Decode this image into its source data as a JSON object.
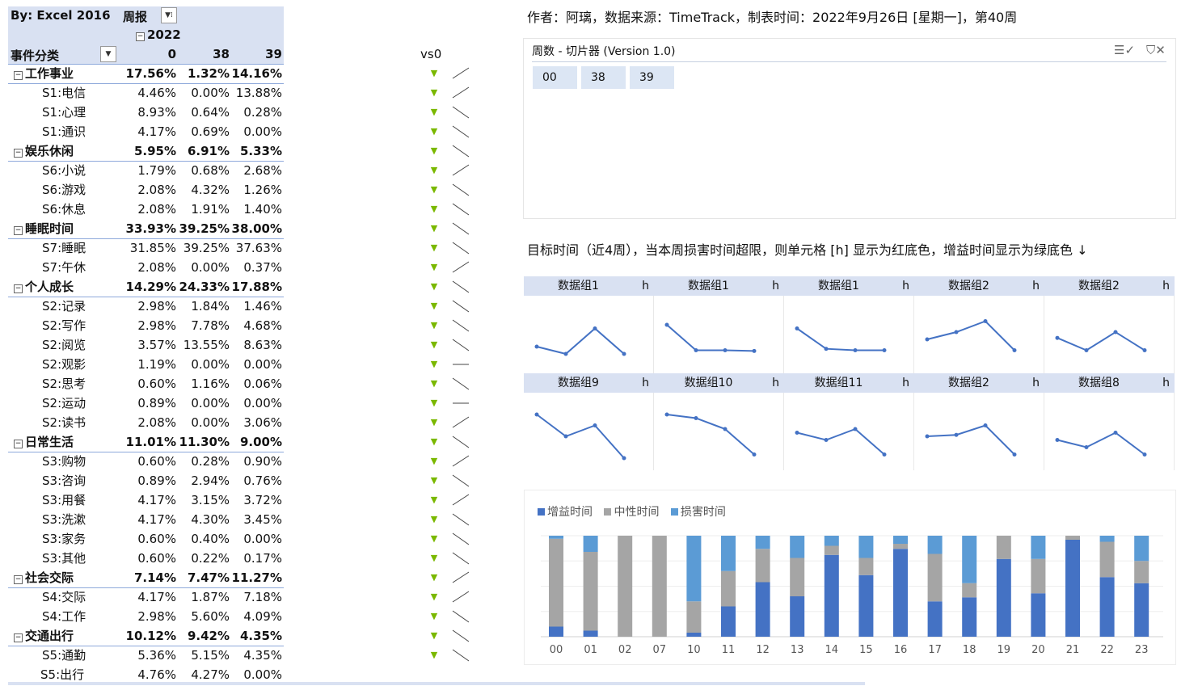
{
  "pivot": {
    "title": "By:  Excel 2016",
    "filter_label": "周报",
    "year": "2022",
    "row_header": "事件分类",
    "columns": [
      "0",
      "38",
      "39"
    ],
    "rows": [
      {
        "label": "工作事业",
        "type": "cat",
        "values": [
          "17.56%",
          "1.32%",
          "14.16%"
        ],
        "trend": "up"
      },
      {
        "label": "S1:电信",
        "type": "sub",
        "values": [
          "4.46%",
          "0.00%",
          "13.88%"
        ],
        "trend": "up"
      },
      {
        "label": "S1:心理",
        "type": "sub",
        "values": [
          "8.93%",
          "0.64%",
          "0.28%"
        ],
        "trend": "down"
      },
      {
        "label": "S1:通识",
        "type": "sub",
        "values": [
          "4.17%",
          "0.69%",
          "0.00%"
        ],
        "trend": "down"
      },
      {
        "label": "娱乐休闲",
        "type": "cat",
        "values": [
          "5.95%",
          "6.91%",
          "5.33%"
        ],
        "trend": "down"
      },
      {
        "label": "S6:小说",
        "type": "sub",
        "values": [
          "1.79%",
          "0.68%",
          "2.68%"
        ],
        "trend": "up"
      },
      {
        "label": "S6:游戏",
        "type": "sub",
        "values": [
          "2.08%",
          "4.32%",
          "1.26%"
        ],
        "trend": "down"
      },
      {
        "label": "S6:休息",
        "type": "sub",
        "values": [
          "2.08%",
          "1.91%",
          "1.40%"
        ],
        "trend": "down"
      },
      {
        "label": "睡眠时间",
        "type": "cat",
        "values": [
          "33.93%",
          "39.25%",
          "38.00%"
        ],
        "trend": "down"
      },
      {
        "label": "S7:睡眠",
        "type": "sub",
        "values": [
          "31.85%",
          "39.25%",
          "37.63%"
        ],
        "trend": "down"
      },
      {
        "label": "S7:午休",
        "type": "sub",
        "values": [
          "2.08%",
          "0.00%",
          "0.37%"
        ],
        "trend": "up"
      },
      {
        "label": "个人成长",
        "type": "cat",
        "values": [
          "14.29%",
          "24.33%",
          "17.88%"
        ],
        "trend": "down"
      },
      {
        "label": "S2:记录",
        "type": "sub",
        "values": [
          "2.98%",
          "1.84%",
          "1.46%"
        ],
        "trend": "down"
      },
      {
        "label": "S2:写作",
        "type": "sub",
        "values": [
          "2.98%",
          "7.78%",
          "4.68%"
        ],
        "trend": "down"
      },
      {
        "label": "S2:阅览",
        "type": "sub",
        "values": [
          "3.57%",
          "13.55%",
          "8.63%"
        ],
        "trend": "down"
      },
      {
        "label": "S2:观影",
        "type": "sub",
        "values": [
          "1.19%",
          "0.00%",
          "0.00%"
        ],
        "trend": "flat"
      },
      {
        "label": "S2:思考",
        "type": "sub",
        "values": [
          "0.60%",
          "1.16%",
          "0.06%"
        ],
        "trend": "down"
      },
      {
        "label": "S2:运动",
        "type": "sub",
        "values": [
          "0.89%",
          "0.00%",
          "0.00%"
        ],
        "trend": "flat"
      },
      {
        "label": "S2:读书",
        "type": "sub",
        "values": [
          "2.08%",
          "0.00%",
          "3.06%"
        ],
        "trend": "up"
      },
      {
        "label": "日常生活",
        "type": "cat",
        "values": [
          "11.01%",
          "11.30%",
          "9.00%"
        ],
        "trend": "down"
      },
      {
        "label": "S3:购物",
        "type": "sub",
        "values": [
          "0.60%",
          "0.28%",
          "0.90%"
        ],
        "trend": "up"
      },
      {
        "label": "S3:咨询",
        "type": "sub",
        "values": [
          "0.89%",
          "2.94%",
          "0.76%"
        ],
        "trend": "down"
      },
      {
        "label": "S3:用餐",
        "type": "sub",
        "values": [
          "4.17%",
          "3.15%",
          "3.72%"
        ],
        "trend": "up"
      },
      {
        "label": "S3:洗漱",
        "type": "sub",
        "values": [
          "4.17%",
          "4.30%",
          "3.45%"
        ],
        "trend": "down"
      },
      {
        "label": "S3:家务",
        "type": "sub",
        "values": [
          "0.60%",
          "0.40%",
          "0.00%"
        ],
        "trend": "down"
      },
      {
        "label": "S3:其他",
        "type": "sub",
        "values": [
          "0.60%",
          "0.22%",
          "0.17%"
        ],
        "trend": "down"
      },
      {
        "label": "社会交际",
        "type": "cat",
        "values": [
          "7.14%",
          "7.47%",
          "11.27%"
        ],
        "trend": "up"
      },
      {
        "label": "S4:交际",
        "type": "sub",
        "values": [
          "4.17%",
          "1.87%",
          "7.18%"
        ],
        "trend": "up"
      },
      {
        "label": "S4:工作",
        "type": "sub",
        "values": [
          "2.98%",
          "5.60%",
          "4.09%"
        ],
        "trend": "down"
      },
      {
        "label": "交通出行",
        "type": "cat",
        "values": [
          "10.12%",
          "9.42%",
          "4.35%"
        ],
        "trend": "down"
      },
      {
        "label": "S5:通勤",
        "type": "sub",
        "values": [
          "5.36%",
          "5.15%",
          "4.35%"
        ],
        "trend": "down"
      },
      {
        "label": "S5:出行",
        "type": "sub",
        "values": [
          "4.76%",
          "4.27%",
          "0.00%"
        ],
        "trend": "none"
      }
    ]
  },
  "vs_label": "vs0",
  "top_note": "作者：阿璃，数据来源：TimeTrack，制表时间：2022年9月26日 [星期一]，第40周",
  "slicer": {
    "title": "周数 - 切片器  (Version 1.0)",
    "items": [
      "00",
      "38",
      "39"
    ]
  },
  "note2": "目标时间（近4周），当本周损害时间超限，则单元格 [h] 显示为红底色，增益时间显示为绿底色 ↓",
  "sparklines": [
    {
      "name": "数据组1",
      "unit": "h",
      "values": [
        0.3,
        0.2,
        0.55,
        0.2
      ]
    },
    {
      "name": "数据组1",
      "unit": "h",
      "values": [
        0.6,
        0.25,
        0.25,
        0.24
      ]
    },
    {
      "name": "数据组1",
      "unit": "h",
      "values": [
        0.55,
        0.27,
        0.25,
        0.25
      ]
    },
    {
      "name": "数据组2",
      "unit": "h",
      "values": [
        0.4,
        0.5,
        0.65,
        0.25
      ]
    },
    {
      "name": "数据组2",
      "unit": "h",
      "values": [
        0.42,
        0.25,
        0.5,
        0.25
      ]
    },
    {
      "name": "数据组9",
      "unit": "h",
      "values": [
        0.7,
        0.4,
        0.55,
        0.1
      ]
    },
    {
      "name": "数据组10",
      "unit": "h",
      "values": [
        0.7,
        0.65,
        0.5,
        0.15
      ]
    },
    {
      "name": "数据组11",
      "unit": "h",
      "values": [
        0.45,
        0.35,
        0.5,
        0.15
      ]
    },
    {
      "name": "数据组2",
      "unit": "h",
      "values": [
        0.4,
        0.42,
        0.55,
        0.15
      ]
    },
    {
      "name": "数据组8",
      "unit": "h",
      "values": [
        0.35,
        0.25,
        0.45,
        0.15
      ]
    }
  ],
  "chart_data": {
    "type": "bar",
    "stacked": true,
    "categories": [
      "00",
      "01",
      "02",
      "07",
      "10",
      "11",
      "12",
      "13",
      "14",
      "15",
      "16",
      "17",
      "18",
      "19",
      "20",
      "21",
      "22",
      "23"
    ],
    "series": [
      {
        "name": "增益时间",
        "color": "#4472c4",
        "values": [
          10,
          6,
          0,
          0,
          4,
          30,
          54,
          40,
          81,
          61,
          87,
          35,
          39,
          77,
          43,
          96,
          59,
          53
        ]
      },
      {
        "name": "中性时间",
        "color": "#a5a5a5",
        "values": [
          87,
          78,
          100,
          100,
          31,
          35,
          33,
          38,
          9,
          17,
          5,
          47,
          14,
          23,
          34,
          4,
          35,
          22
        ]
      },
      {
        "name": "损害时间",
        "color": "#5b9bd5",
        "values": [
          3,
          16,
          0,
          0,
          65,
          35,
          13,
          22,
          10,
          22,
          8,
          18,
          47,
          0,
          23,
          0,
          6,
          25
        ]
      }
    ],
    "legend": [
      "增益时间",
      "中性时间",
      "损害时间"
    ],
    "legend_position": "top-left",
    "ylim": [
      0,
      100
    ],
    "grid": true
  }
}
